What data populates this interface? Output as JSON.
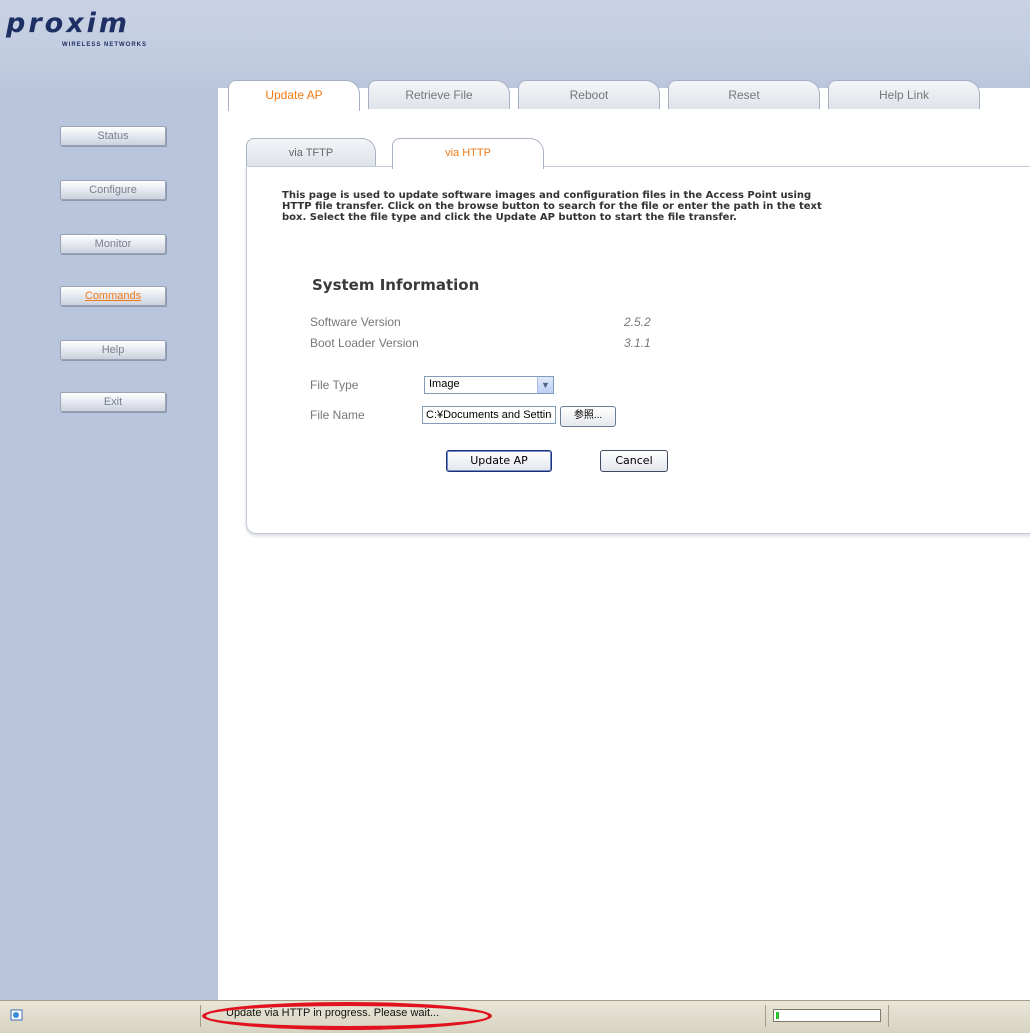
{
  "brand": {
    "name": "proxim",
    "tagline": "WIRELESS NETWORKS"
  },
  "sidebar": {
    "items": [
      {
        "label": "Status",
        "active": false
      },
      {
        "label": "Configure",
        "active": false
      },
      {
        "label": "Monitor",
        "active": false
      },
      {
        "label": "Commands",
        "active": true
      },
      {
        "label": "Help",
        "active": false
      },
      {
        "label": "Exit",
        "active": false
      }
    ]
  },
  "tabs": [
    {
      "label": "Update AP",
      "active": true
    },
    {
      "label": "Retrieve File",
      "active": false
    },
    {
      "label": "Reboot",
      "active": false
    },
    {
      "label": "Reset",
      "active": false
    },
    {
      "label": "Help Link",
      "active": false
    }
  ],
  "subtabs": [
    {
      "label": "via TFTP",
      "active": false
    },
    {
      "label": "via HTTP",
      "active": true
    }
  ],
  "description": "This page is used to update software images and configuration files in the Access Point using HTTP file transfer. Click on the browse button to search for the file or enter the path in the text box. Select the file type and click the Update AP button to start the file transfer.",
  "system_info": {
    "title": "System Information",
    "rows": [
      {
        "label": "Software Version",
        "value": "2.5.2"
      },
      {
        "label": "Boot Loader Version",
        "value": "3.1.1"
      }
    ]
  },
  "form": {
    "file_type_label": "File Type",
    "file_type_value": "Image",
    "file_name_label": "File Name",
    "file_name_value": "C:¥Documents and Settings",
    "browse_label": "参照...",
    "update_label": "Update AP",
    "cancel_label": "Cancel"
  },
  "statusbar": {
    "text": "Update via HTTP in progress. Please wait...",
    "progress": 0.03,
    "highlight_color": "#e1121e"
  },
  "colors": {
    "accent": "#f07a18",
    "sidebar": "#b9c5dc"
  }
}
